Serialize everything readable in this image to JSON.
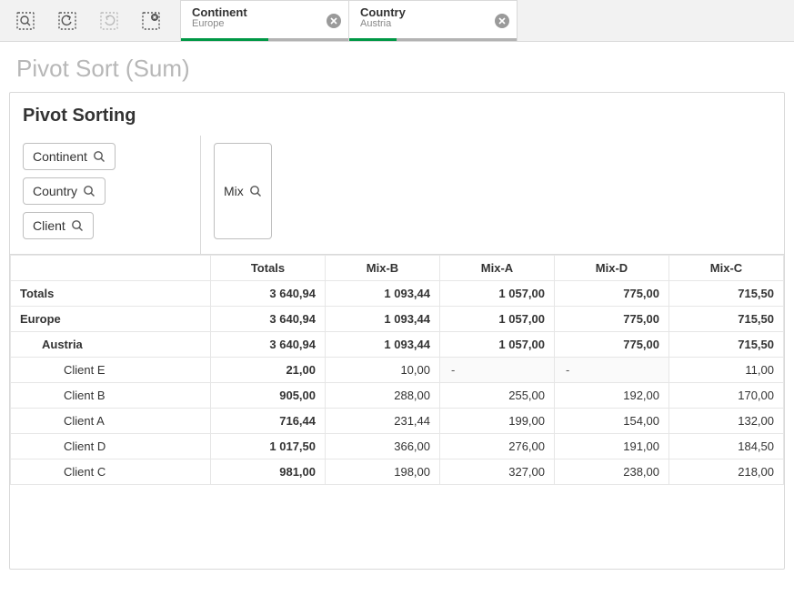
{
  "toolbar": {
    "filters": [
      {
        "title": "Continent",
        "value": "Europe",
        "bar_pct": 52
      },
      {
        "title": "Country",
        "value": "Austria",
        "bar_pct": 28
      }
    ]
  },
  "page": {
    "title": "Pivot Sort (Sum)"
  },
  "card": {
    "title": "Pivot Sorting",
    "row_dims": [
      "Continent",
      "Country",
      "Client"
    ],
    "col_dims": [
      "Mix"
    ]
  },
  "pivot": {
    "col_headers": [
      "Totals",
      "Mix-B",
      "Mix-A",
      "Mix-D",
      "Mix-C"
    ],
    "rows": [
      {
        "label": "Totals",
        "indent": 0,
        "bold": true,
        "cells": [
          "3 640,94",
          "1 093,44",
          "1 057,00",
          "775,00",
          "715,50"
        ]
      },
      {
        "label": "Europe",
        "indent": 0,
        "bold": true,
        "cells": [
          "3 640,94",
          "1 093,44",
          "1 057,00",
          "775,00",
          "715,50"
        ]
      },
      {
        "label": "Austria",
        "indent": 1,
        "bold": true,
        "cells": [
          "3 640,94",
          "1 093,44",
          "1 057,00",
          "775,00",
          "715,50"
        ]
      },
      {
        "label": "Client E",
        "indent": 2,
        "bold": false,
        "cells": [
          "21,00",
          "10,00",
          "-",
          "-",
          "11,00"
        ]
      },
      {
        "label": "Client B",
        "indent": 2,
        "bold": false,
        "cells": [
          "905,00",
          "288,00",
          "255,00",
          "192,00",
          "170,00"
        ]
      },
      {
        "label": "Client A",
        "indent": 2,
        "bold": false,
        "cells": [
          "716,44",
          "231,44",
          "199,00",
          "154,00",
          "132,00"
        ]
      },
      {
        "label": "Client D",
        "indent": 2,
        "bold": false,
        "cells": [
          "1 017,50",
          "366,00",
          "276,00",
          "191,00",
          "184,50"
        ]
      },
      {
        "label": "Client C",
        "indent": 2,
        "bold": false,
        "cells": [
          "981,00",
          "198,00",
          "327,00",
          "238,00",
          "218,00"
        ]
      }
    ]
  }
}
